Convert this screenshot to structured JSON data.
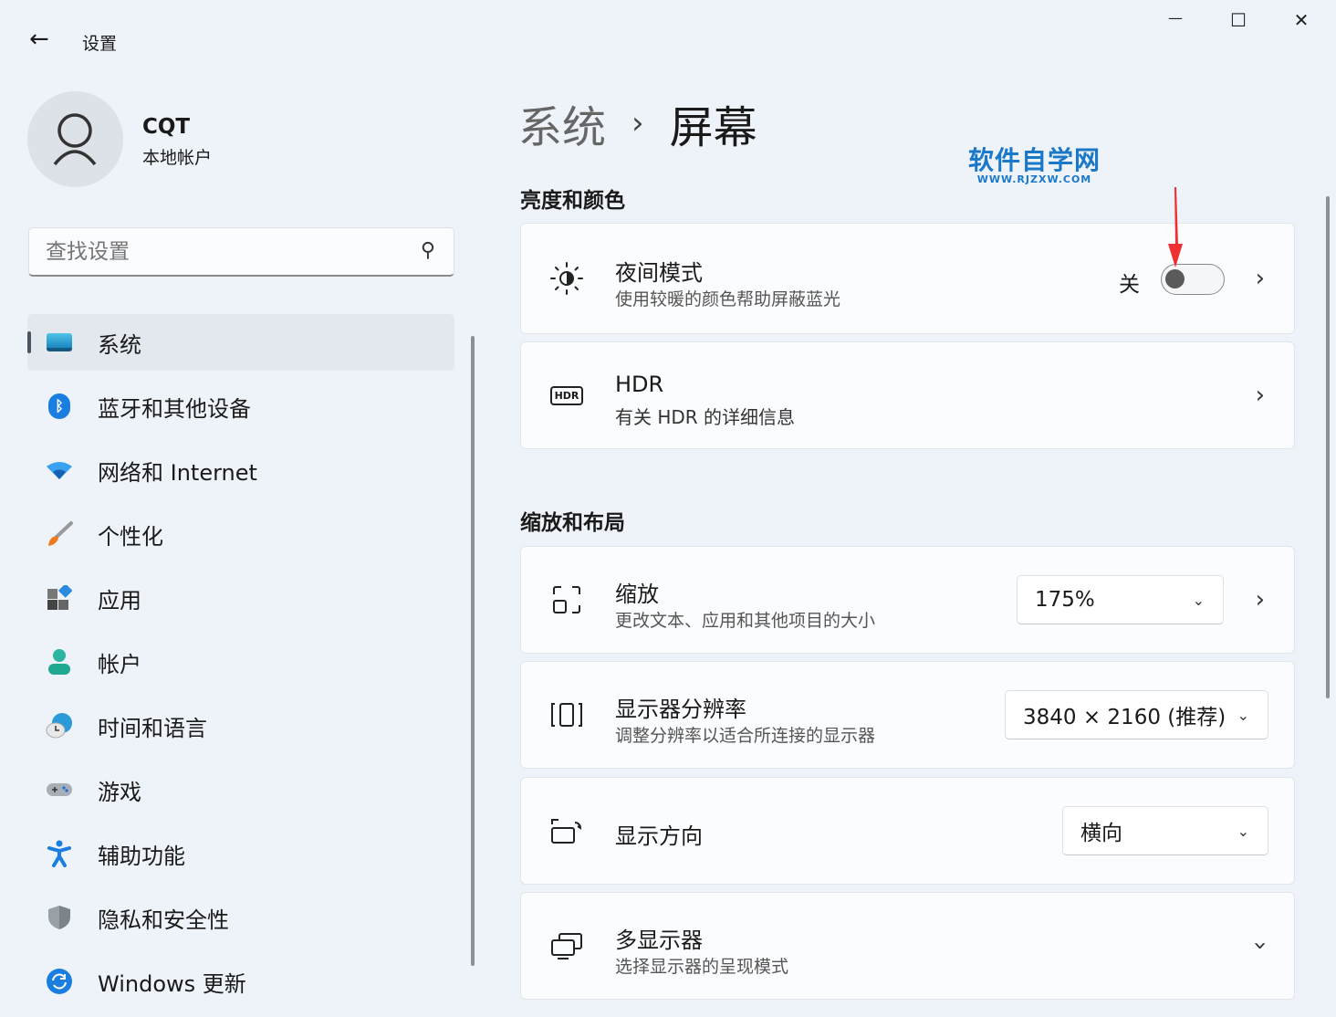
{
  "window": {
    "title": "设置",
    "back": "←",
    "minimize": "—",
    "maximize": "☐",
    "close": "✕"
  },
  "user": {
    "name": "CQT",
    "type": "本地帐户"
  },
  "search": {
    "placeholder": "查找设置"
  },
  "sidebar": {
    "items": [
      {
        "label": "系统",
        "icon": "system-icon"
      },
      {
        "label": "蓝牙和其他设备",
        "icon": "bluetooth-icon"
      },
      {
        "label": "网络和 Internet",
        "icon": "wifi-icon"
      },
      {
        "label": "个性化",
        "icon": "brush-icon"
      },
      {
        "label": "应用",
        "icon": "apps-icon"
      },
      {
        "label": "帐户",
        "icon": "account-icon"
      },
      {
        "label": "时间和语言",
        "icon": "time-language-icon"
      },
      {
        "label": "游戏",
        "icon": "gamepad-icon"
      },
      {
        "label": "辅助功能",
        "icon": "accessibility-icon"
      },
      {
        "label": "隐私和安全性",
        "icon": "shield-icon"
      },
      {
        "label": "Windows 更新",
        "icon": "update-icon"
      }
    ]
  },
  "breadcrumb": {
    "parent": "系统",
    "sep": "›",
    "current": "屏幕"
  },
  "watermark": {
    "cn": "软件自学网",
    "url": "WWW.RJZXW.COM"
  },
  "sections": {
    "brightness": "亮度和颜色",
    "layout": "缩放和布局"
  },
  "night": {
    "title": "夜间模式",
    "sub": "使用较暖的颜色帮助屏蔽蓝光",
    "state": "关",
    "on": false
  },
  "hdr": {
    "title": "HDR",
    "sub": "有关 HDR 的详细信息",
    "badge": "HDR"
  },
  "scale": {
    "title": "缩放",
    "sub": "更改文本、应用和其他项目的大小",
    "value": "175%"
  },
  "resolution": {
    "title": "显示器分辨率",
    "sub": "调整分辨率以适合所连接的显示器",
    "value": "3840 × 2160 (推荐)"
  },
  "orientation": {
    "title": "显示方向",
    "value": "横向"
  },
  "multi": {
    "title": "多显示器",
    "sub": "选择显示器的呈现模式"
  },
  "colors": {
    "accent": "#0067c0",
    "arrow": "#f03030"
  }
}
